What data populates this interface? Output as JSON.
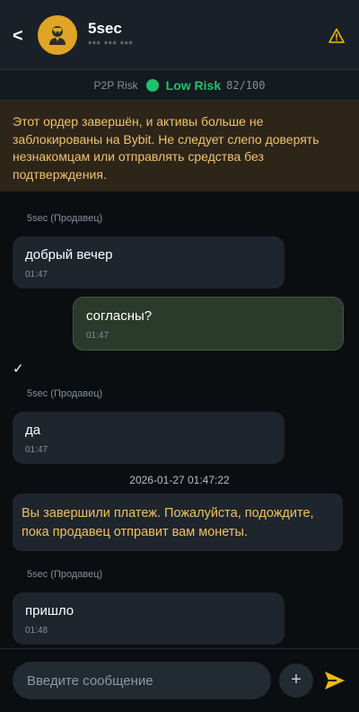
{
  "header": {
    "back_label": "<",
    "name": "5sec",
    "masked": "*** *** ***",
    "avatar_icon": "user-avatar-icon",
    "warning_icon": "warning-triangle-icon"
  },
  "risk": {
    "label": "P2P Risk",
    "level": "Low Risk",
    "score": "82/100",
    "color": "#1fc16b"
  },
  "banner": {
    "text": "Этот ордер завершён, и активы больше не заблокированы на Bybit. Не следует слепо доверять незнакомцам или отправлять средства без подтверждения."
  },
  "messages": [
    {
      "sender": "5sec (Продавец)",
      "text": "добрый вечер",
      "time": "01:47"
    },
    {
      "text": "согласны?",
      "time": "01:47"
    },
    {
      "check": "✓"
    },
    {
      "sender": "5sec (Продавец)",
      "text": "да",
      "time": "01:47"
    },
    {
      "timestamp": "2026-01-27 01:47:22"
    },
    {
      "system": "Вы завершили платеж. Пожалуйста, подождите, пока продавец отправит вам монеты."
    },
    {
      "sender": "5sec (Продавец)",
      "text": "пришло",
      "time": "01:48"
    }
  ],
  "input": {
    "placeholder": "Введите сообщение",
    "add_label": "+",
    "send_icon": "send-plane-icon"
  },
  "colors": {
    "accent": "#f0b90b",
    "background": "#0b0e11",
    "bubble": "#1e252d",
    "own_bubble": "#2a3b2b"
  }
}
